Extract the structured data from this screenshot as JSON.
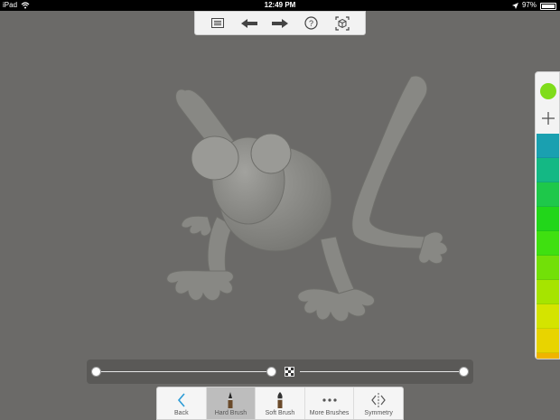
{
  "status_bar": {
    "device": "iPad",
    "time": "12:49 PM",
    "battery": "97%",
    "wifi_icon": "wifi-icon",
    "location_icon": "location-arrow-icon"
  },
  "top_toolbar": {
    "items": [
      {
        "name": "gallery-button",
        "icon": "list-icon"
      },
      {
        "name": "undo-button",
        "icon": "arrow-left-icon"
      },
      {
        "name": "redo-button",
        "icon": "arrow-right-icon"
      },
      {
        "name": "help-button",
        "icon": "question-icon"
      },
      {
        "name": "camera-button",
        "icon": "cube-view-icon"
      }
    ]
  },
  "palette": {
    "current_color": "#7fdc1a",
    "add_icon": "plus-icon",
    "swatches": [
      "#1aa0b0",
      "#14b884",
      "#1ec84a",
      "#22d61a",
      "#3fe010",
      "#72e008",
      "#a6e400",
      "#d4e400",
      "#e8d400",
      "#f0b400",
      "#f59800"
    ]
  },
  "slider": {
    "size_value": 0.0,
    "strength_value": 1.0,
    "opacity_icon": "checkerboard-icon"
  },
  "bottom_toolbar": {
    "back": "Back",
    "hard_brush": "Hard Brush",
    "soft_brush": "Soft Brush",
    "more_brushes": "More Brushes",
    "symmetry": "Symmetry"
  },
  "colors": {
    "background": "#6b6a68",
    "model": "#8a8a86",
    "accent": "#2b9bd6"
  }
}
